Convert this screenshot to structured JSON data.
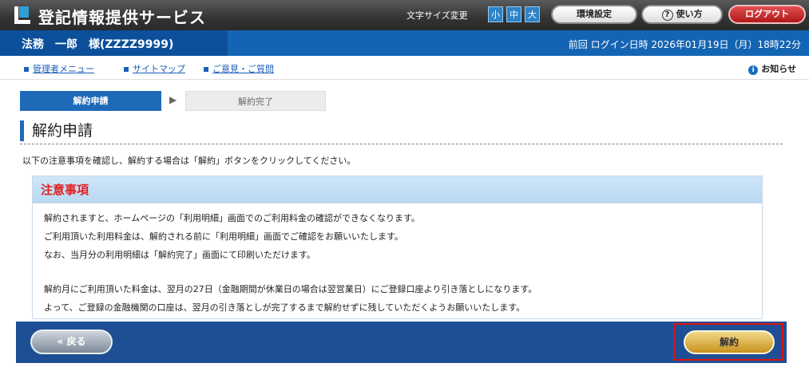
{
  "header": {
    "site_title": "登記情報提供サービス",
    "font_size_label": "文字サイズ変更",
    "font_sizes": [
      "小",
      "中",
      "大"
    ],
    "env_settings": "環境設定",
    "help": "使い方",
    "logout": "ログアウト"
  },
  "user": {
    "name": "法務　一郎　様(ZZZZ9999)",
    "last_login": "前回 ログイン日時 2026年01月19日（月）18時22分"
  },
  "links": {
    "admin_menu": "管理者メニュー",
    "sitemap": "サイトマップ",
    "feedback": "ご意見・ご質問",
    "notice": "お知らせ"
  },
  "steps": {
    "current": "解約申請",
    "next": "解約完了"
  },
  "page": {
    "title": "解約申請",
    "instruction": "以下の注意事項を確認し、解約する場合は「解約」ボタンをクリックしてください。"
  },
  "caution": {
    "title": "注意事項",
    "lines": [
      "解約されますと、ホームページの「利用明細」画面でのご利用料金の確認ができなくなります。",
      "ご利用頂いた利用料金は、解約される前に「利用明細」画面でご確認をお願いいたします。",
      "なお、当月分の利用明細は「解約完了」画面にて印刷いただけます。",
      "解約月にご利用頂いた料金は、翌月の27日（金融期間が休業日の場合は翌営業日）にご登録口座より引き落としになります。",
      "よって、ご登録の金融機関の口座は、翌月の引き落としが完了するまで解約せずに残していただくようお願いいたします。"
    ]
  },
  "buttons": {
    "back": "« 戻る",
    "cancel": "解約"
  }
}
